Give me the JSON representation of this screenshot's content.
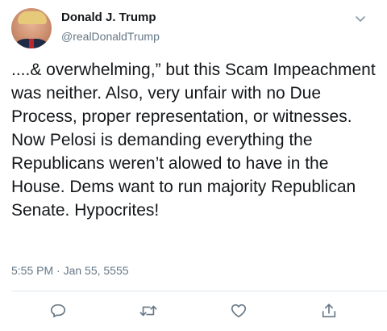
{
  "author": {
    "name": "Donald J. Trump",
    "handle": "@realDonaldTrump"
  },
  "tweet": {
    "text": "....& overwhelming,” but this Scam Impeachment was neither. Also, very unfair with no Due Process, proper representation, or witnesses. Now Pelosi is demanding everything the Republicans weren’t alowed to have in the House. Dems want to run majority Republican Senate. Hypocrites!",
    "timestamp": "5:55 PM · Jan 55, 5555"
  },
  "icons": {
    "menu": "chevron-down-icon",
    "reply": "reply-icon",
    "retweet": "retweet-icon",
    "like": "heart-icon",
    "share": "share-icon"
  },
  "colors": {
    "text": "#14171a",
    "secondary": "#657786",
    "divider": "#e1e8ed",
    "icon": "#657786"
  }
}
